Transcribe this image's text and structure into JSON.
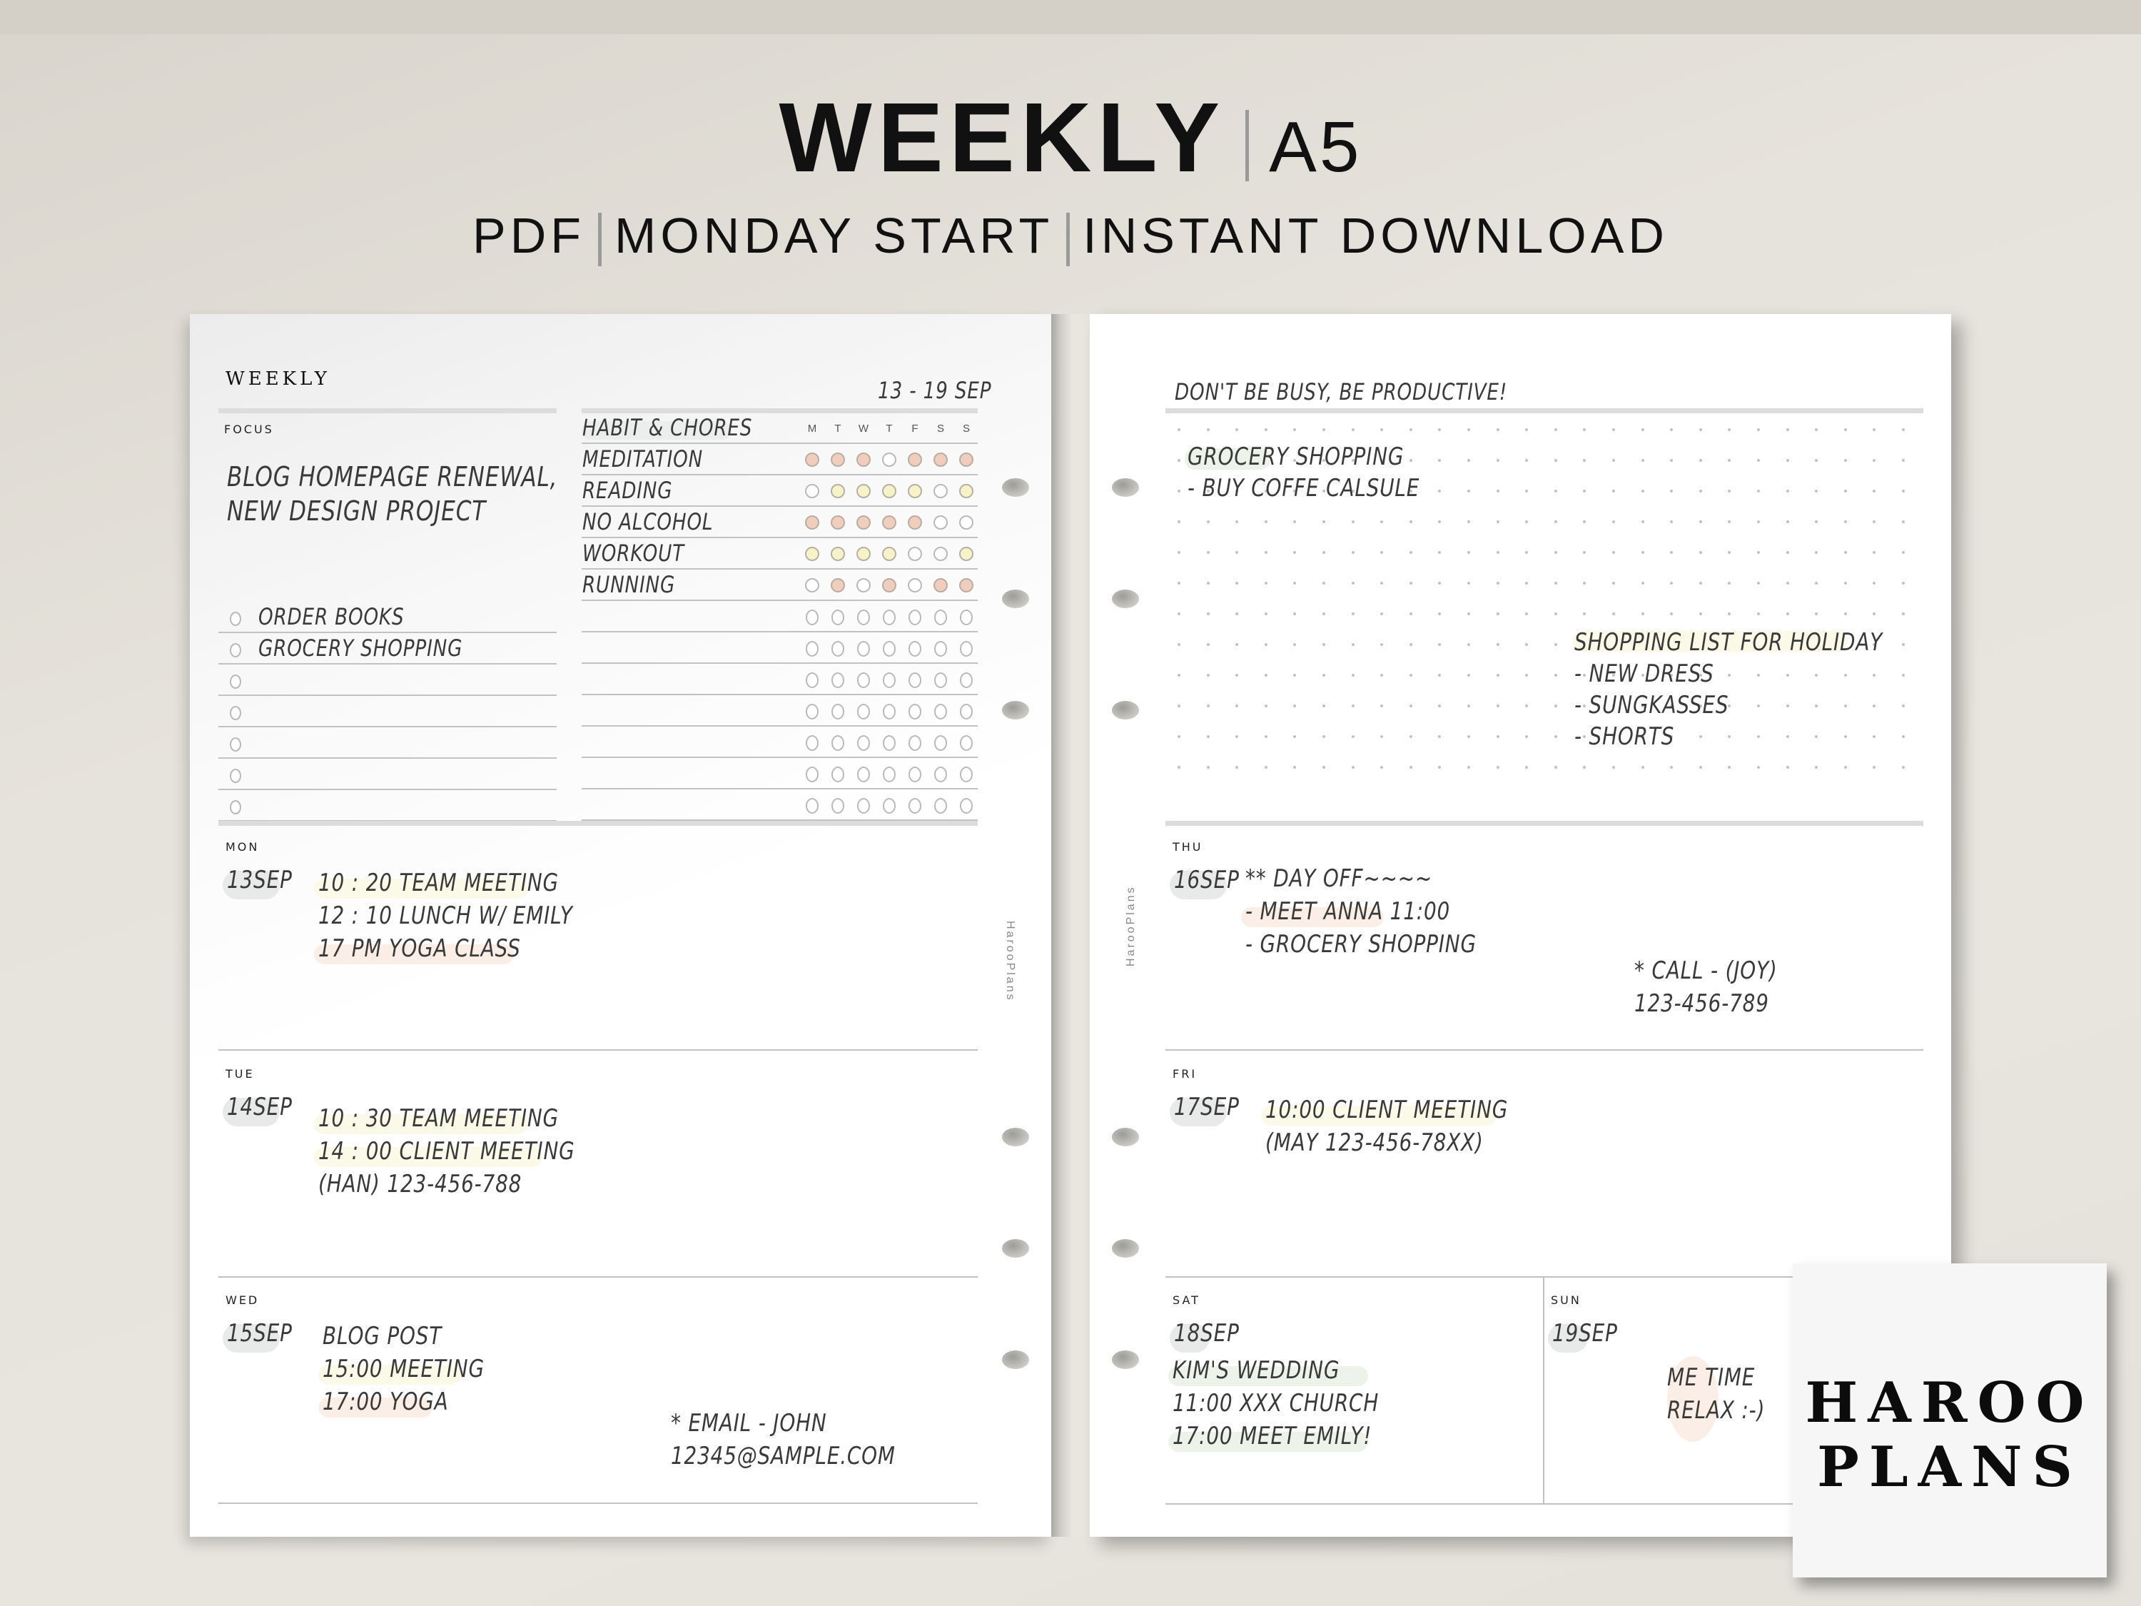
{
  "banner": {
    "title": "WEEKLY",
    "size": "A5",
    "subtitle_parts": [
      "PDF",
      "MONDAY START",
      "INSTANT DOWNLOAD"
    ]
  },
  "left_page": {
    "header": "WEEKLY",
    "date_range": "13 - 19 SEP",
    "focus_label": "FOCUS",
    "focus_lines": [
      "BLOG HOMEPAGE RENEWAL,",
      "NEW DESIGN PROJECT"
    ],
    "tasks": [
      "ORDER BOOKS",
      "GROCERY SHOPPING",
      "",
      "",
      "",
      "",
      ""
    ],
    "habits": {
      "title": "HABIT & CHORES",
      "day_letters": [
        "M",
        "T",
        "W",
        "T",
        "F",
        "S",
        "S"
      ],
      "rows": [
        {
          "name": "MEDITATION",
          "marks": [
            "peach",
            "peach",
            "peach",
            "empty",
            "peach",
            "peach",
            "peach"
          ]
        },
        {
          "name": "READING",
          "marks": [
            "empty",
            "yellow",
            "yellow",
            "yellow",
            "yellow",
            "empty",
            "yellow"
          ]
        },
        {
          "name": "NO ALCOHOL",
          "marks": [
            "peach",
            "peach",
            "peach",
            "peach",
            "peach",
            "empty",
            "empty"
          ]
        },
        {
          "name": "WORKOUT",
          "marks": [
            "yellow",
            "yellow",
            "yellow",
            "yellow",
            "empty",
            "empty",
            "yellow"
          ]
        },
        {
          "name": "RUNNING",
          "marks": [
            "empty",
            "peach",
            "empty",
            "peach",
            "empty",
            "peach",
            "peach"
          ]
        },
        {
          "name": "",
          "marks": [
            "empty",
            "empty",
            "empty",
            "empty",
            "empty",
            "empty",
            "empty"
          ]
        },
        {
          "name": "",
          "marks": [
            "empty",
            "empty",
            "empty",
            "empty",
            "empty",
            "empty",
            "empty"
          ]
        },
        {
          "name": "",
          "marks": [
            "empty",
            "empty",
            "empty",
            "empty",
            "empty",
            "empty",
            "empty"
          ]
        },
        {
          "name": "",
          "marks": [
            "empty",
            "empty",
            "empty",
            "empty",
            "empty",
            "empty",
            "empty"
          ]
        },
        {
          "name": "",
          "marks": [
            "empty",
            "empty",
            "empty",
            "empty",
            "empty",
            "empty",
            "empty"
          ]
        },
        {
          "name": "",
          "marks": [
            "empty",
            "empty",
            "empty",
            "empty",
            "empty",
            "empty",
            "empty"
          ]
        },
        {
          "name": "",
          "marks": [
            "empty",
            "empty",
            "empty",
            "empty",
            "empty",
            "empty",
            "empty"
          ]
        }
      ]
    },
    "days": [
      {
        "day": "MON",
        "date": "13SEP",
        "lines": [
          "10 : 20  TEAM MEETING",
          "12 : 10  LUNCH W/ EMILY",
          "17 PM  YOGA CLASS"
        ],
        "note": []
      },
      {
        "day": "TUE",
        "date": "14SEP",
        "lines": [
          "10 : 30 TEAM MEETING",
          "14 : 00 CLIENT MEETING",
          "(HAN) 123-456-788"
        ],
        "note": []
      },
      {
        "day": "WED",
        "date": "15SEP",
        "lines": [
          "BLOG POST",
          "15:00 MEETING",
          "17:00 YOGA"
        ],
        "note": [
          "* EMAIL - JOHN",
          "12345@SAMPLE.COM"
        ]
      }
    ],
    "vertical_brand": "HarooPlans"
  },
  "right_page": {
    "quote": "DON'T BE BUSY, BE PRODUCTIVE!",
    "notes_a": [
      "GROCERY SHOPPING",
      "- BUY COFFE CALSULE"
    ],
    "notes_b": [
      "SHOPPING LIST FOR HOLIDAY",
      "- NEW DRESS",
      "- SUNGKASSES",
      "- SHORTS"
    ],
    "days": [
      {
        "day": "THU",
        "date": "16SEP",
        "lines": [
          "** DAY OFF~~~~",
          "- MEET ANNA 11:00",
          "- GROCERY SHOPPING"
        ],
        "note": [
          "* CALL - (JOY)",
          "123-456-789"
        ]
      },
      {
        "day": "FRI",
        "date": "17SEP",
        "lines": [
          "10:00 CLIENT MEETING",
          "(MAY 123-456-78XX)"
        ],
        "note": []
      },
      {
        "day": "SAT",
        "date": "18SEP",
        "lines": [
          "KIM'S  WEDDING",
          "11:00 XXX CHURCH",
          "17:00 MEET EMILY!"
        ],
        "note": []
      },
      {
        "day": "SUN",
        "date": "19SEP",
        "lines": [],
        "note": [
          "ME TIME",
          "RELAX :-)"
        ]
      }
    ],
    "vertical_brand": "HarooPlans"
  },
  "logo": {
    "line1": "HAROO",
    "line2": "PLANS"
  },
  "colors": {
    "peach": "#f1cdbb",
    "yellow": "#f7f3c8",
    "highlight_yellow": "#fbfae9",
    "highlight_peach": "#fbeee6",
    "highlight_green": "#eef3ea",
    "pill_gray": "#e8eaea"
  }
}
